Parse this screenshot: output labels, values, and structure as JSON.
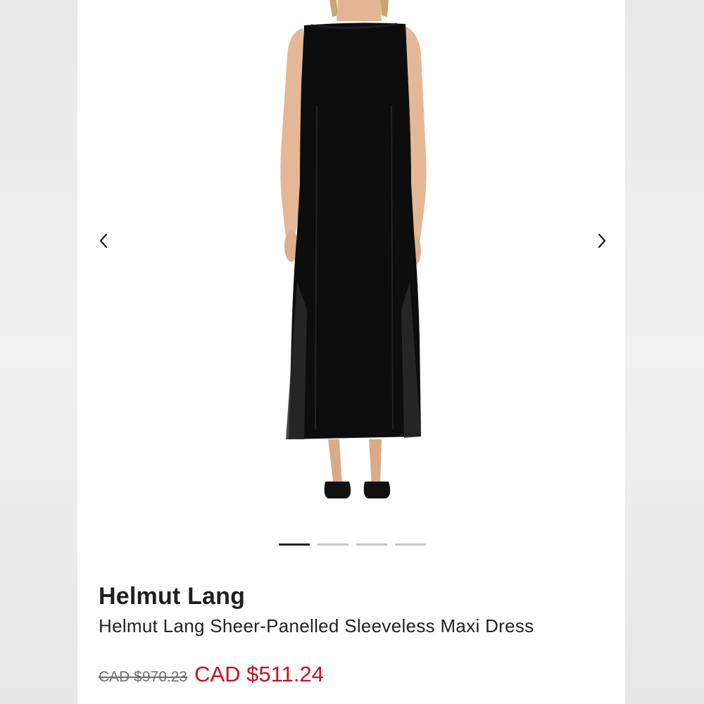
{
  "product": {
    "brand": "Helmut Lang",
    "title": "Helmut Lang Sheer-Panelled Sleeveless Maxi Dress",
    "original_price": "CAD $970.23",
    "sale_price": "CAD $511.24"
  },
  "gallery": {
    "image_count": 4,
    "active_index": 0
  },
  "colors": {
    "sale_price": "#c0141c",
    "active_indicator": "#222222",
    "inactive_indicator": "#c9c9c9"
  },
  "icons": {
    "prev": "chevron-left-icon",
    "next": "chevron-right-icon"
  }
}
